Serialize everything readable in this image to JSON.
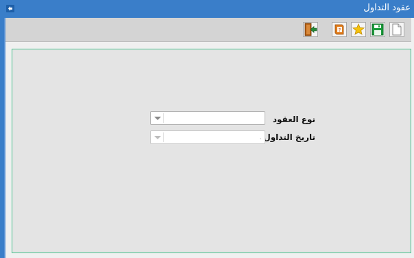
{
  "window": {
    "title": "عقود التداول"
  },
  "toolbar": {
    "buttons": [
      {
        "name": "new-document-icon"
      },
      {
        "name": "save-icon",
        "color": "#1a9b3a"
      },
      {
        "name": "favorite-star-icon",
        "color": "#f4c20d"
      },
      {
        "name": "help-book-icon",
        "color": "#e07b1b"
      },
      {
        "name": "exit-door-icon",
        "color": "#2a8a3c"
      }
    ]
  },
  "form": {
    "contract_type": {
      "label": "نوع العقود",
      "value": ""
    },
    "trading_date": {
      "label": "تاريخ التداول",
      "value": "."
    }
  },
  "colors": {
    "titlebar": "#3a7ec9",
    "panel_border": "#42c08a",
    "panel_bg": "#e4e4e4",
    "toolbar_bg": "#d4d4d4"
  }
}
